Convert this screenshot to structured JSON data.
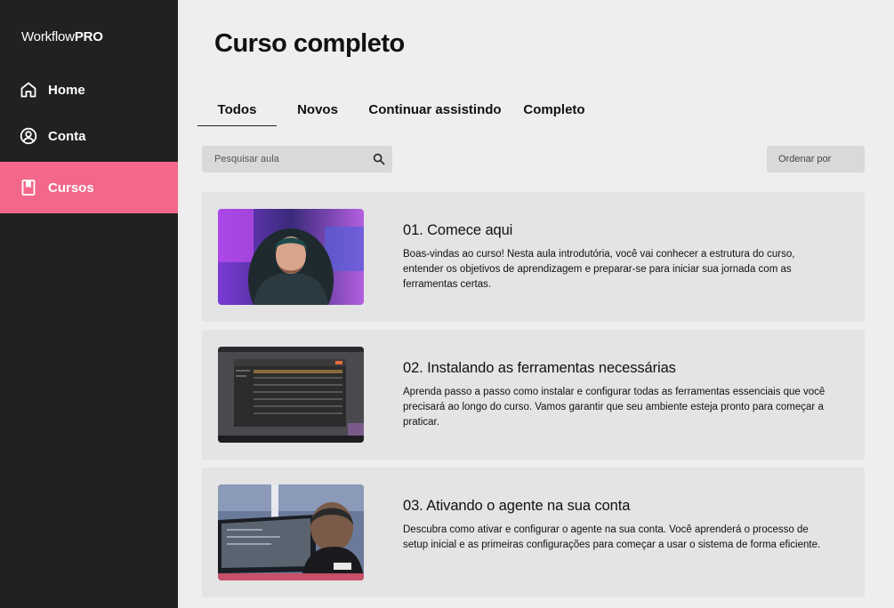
{
  "sidebar": {
    "logo_regular": "Workflow",
    "logo_bold": "PRO",
    "items": [
      {
        "label": "Home",
        "icon": "home-icon"
      },
      {
        "label": "Conta",
        "icon": "user-circle-icon"
      },
      {
        "label": "Cursos",
        "icon": "book-icon"
      }
    ],
    "active_color": "#f2678a",
    "background": "#212121"
  },
  "main": {
    "title": "Curso completo",
    "tabs": [
      {
        "label": "Todos",
        "active": true
      },
      {
        "label": "Novos",
        "active": false
      },
      {
        "label": "Continuar assistindo",
        "active": false
      },
      {
        "label": "Completo",
        "active": false
      }
    ],
    "search": {
      "placeholder": "Pesquisar aula"
    },
    "sort_label": "Ordenar por",
    "lessons": [
      {
        "title": "01. Comece aqui",
        "description": "Boas-vindas ao curso! Nesta aula introdutória, você vai conhecer a estrutura do curso, entender os objetivos de aprendizagem e preparar-se para iniciar sua jornada com as ferramentas certas."
      },
      {
        "title": "02. Instalando as ferramentas necessárias",
        "description": "Aprenda passo a passo como instalar e configurar todas as ferramentas essenciais que você precisará ao longo do curso. Vamos garantir que seu ambiente esteja pronto para começar a praticar."
      },
      {
        "title": "03. Ativando o agente na sua conta",
        "description": "Descubra como ativar e configurar o agente na sua conta. Você aprenderá o processo de setup inicial e as primeiras configurações para começar a usar o sistema de forma eficiente."
      }
    ]
  }
}
